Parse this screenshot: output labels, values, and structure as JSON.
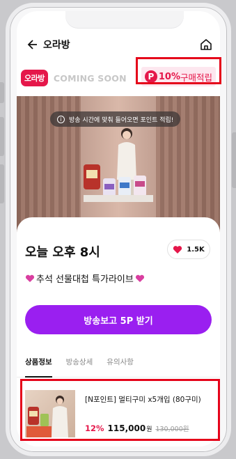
{
  "header": {
    "title": "오라방"
  },
  "brand": {
    "logo_text": "오라방",
    "coming_soon": "COMING SOON",
    "point_icon": "P",
    "point_percent": "10%",
    "point_label": "구매적립"
  },
  "video": {
    "notice": "방송 시간에 맞춰 들어오면 포인트 적립!"
  },
  "live": {
    "time": "오늘 오후 8시",
    "likes": "1.5K",
    "subtitle": "추석 선물대첩 특가라이브"
  },
  "cta": {
    "label": "방송보고 5P 받기"
  },
  "tabs": [
    {
      "label": "상품정보"
    },
    {
      "label": "방송상세"
    },
    {
      "label": "유의사항"
    }
  ],
  "product": {
    "name": "[N포인트] 멀티구미 x5개입 (80구미)",
    "discount": "12%",
    "price": "115,000",
    "unit": "원",
    "original_price": "130,000원"
  },
  "colors": {
    "accent": "#9a1ff0",
    "brand": "#e5174a",
    "highlight": "#e5041a"
  }
}
